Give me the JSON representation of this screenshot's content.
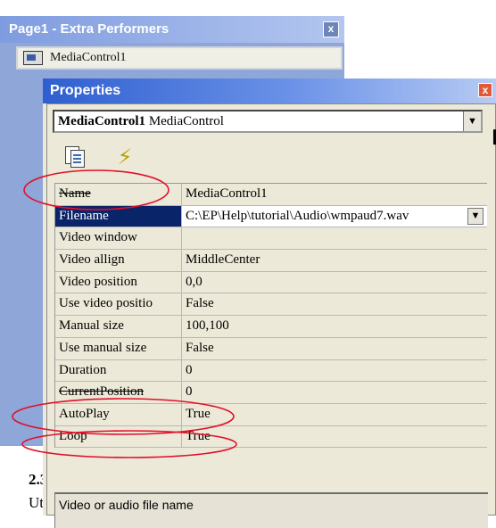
{
  "background_window": {
    "title": "Page1 - Extra Performers",
    "close_label": "x",
    "item_label": "MediaControl1"
  },
  "properties_window": {
    "title": "Properties",
    "close_label": "x",
    "object_name": "MediaControl1",
    "object_type": "MediaControl",
    "toolbar": {
      "pages_icon": "property-pages-icon",
      "events_icon": "lightning-bolt-icon"
    },
    "rows": [
      {
        "name": "Name",
        "value": "MediaControl1"
      },
      {
        "name": "Filename",
        "value": "C:\\EP\\Help\\tutorial\\Audio\\wmpaud7.wav"
      },
      {
        "name": "Video window",
        "value": ""
      },
      {
        "name": "Video allign",
        "value": "MiddleCenter"
      },
      {
        "name": "Video position",
        "value": "0,0"
      },
      {
        "name": "Use video positio",
        "value": "False"
      },
      {
        "name": "Manual size",
        "value": "100,100"
      },
      {
        "name": "Use  manual size",
        "value": "False"
      },
      {
        "name": "Duration",
        "value": "0"
      },
      {
        "name": "CurrentPosition",
        "value": "0"
      },
      {
        "name": "AutoPlay",
        "value": "True"
      },
      {
        "name": "Loop",
        "value": "True"
      }
    ],
    "description": "Video or audio file name"
  },
  "background_text": {
    "line1": "2.3",
    "line2": "Ut"
  },
  "colors": {
    "annotation_oval": "#e0102a",
    "selected_row": "#0a246a",
    "title_bar": "#2f5fcf"
  }
}
